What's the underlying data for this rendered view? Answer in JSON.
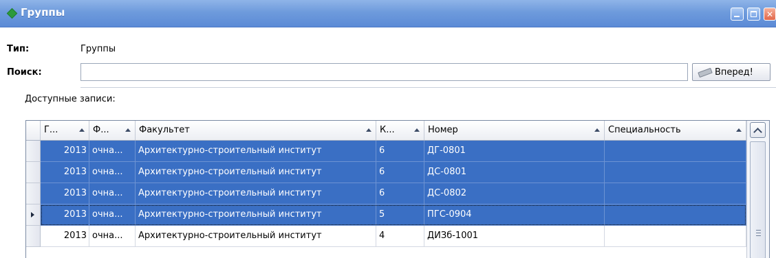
{
  "window": {
    "title": "Группы"
  },
  "form": {
    "type_label": "Тип:",
    "type_value": "Группы",
    "search_label": "Поиск:",
    "search_value": "",
    "forward_button": "Вперед!",
    "available_label": "Доступные записи:"
  },
  "grid": {
    "columns": [
      "Г...",
      "Ф...",
      "Факультет",
      "К...",
      "Номер",
      "Специальность"
    ],
    "rows": [
      {
        "year": "2013",
        "form": "очна...",
        "faculty": "Архитектурно-строительный институт",
        "course": "6",
        "number": "ДГ-0801",
        "specialty": "",
        "selected": true,
        "current": false
      },
      {
        "year": "2013",
        "form": "очна...",
        "faculty": "Архитектурно-строительный институт",
        "course": "6",
        "number": "ДС-0801",
        "specialty": "",
        "selected": true,
        "current": false
      },
      {
        "year": "2013",
        "form": "очна...",
        "faculty": "Архитектурно-строительный институт",
        "course": "6",
        "number": "ДС-0802",
        "specialty": "",
        "selected": true,
        "current": false
      },
      {
        "year": "2013",
        "form": "очна...",
        "faculty": "Архитектурно-строительный институт",
        "course": "5",
        "number": "ПГС-0904",
        "specialty": "",
        "selected": true,
        "current": true
      },
      {
        "year": "2013",
        "form": "очна...",
        "faculty": "Архитектурно-строительный институт",
        "course": "4",
        "number": "ДИЗб-1001",
        "specialty": "",
        "selected": false,
        "current": false
      }
    ]
  },
  "colors": {
    "title_bar": "#6e9bdc",
    "selection": "#3a6fc4"
  }
}
